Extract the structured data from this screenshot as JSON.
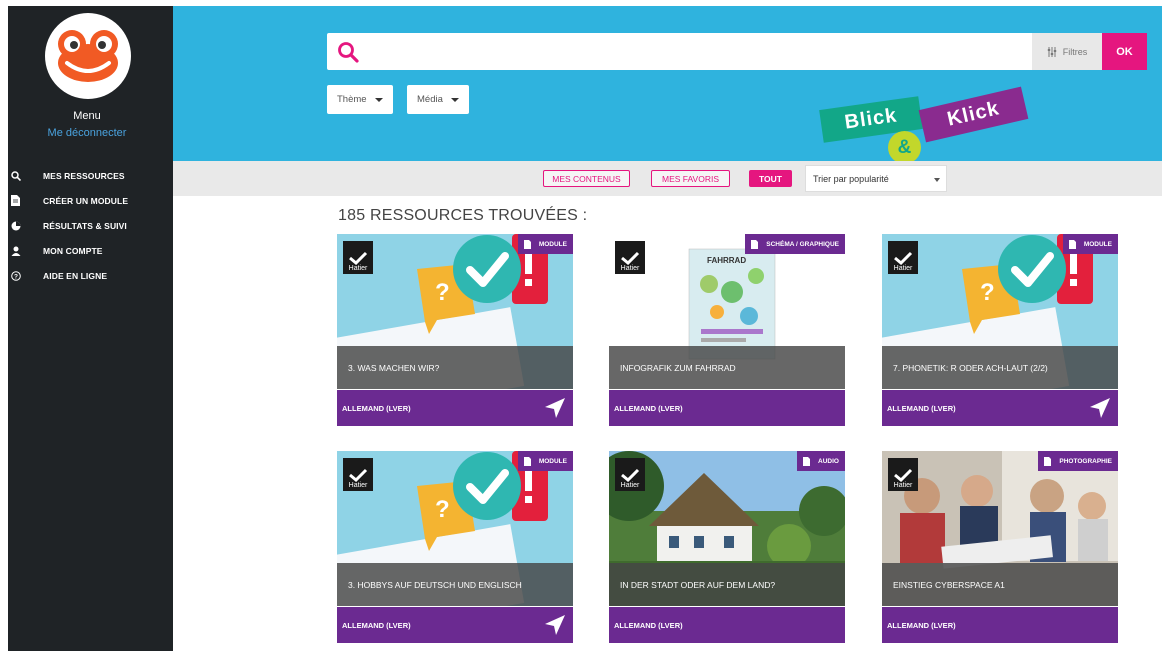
{
  "sidebar": {
    "menu_label": "Menu",
    "logout_label": "Me déconnecter",
    "items": [
      {
        "label": "MES RESSOURCES",
        "icon": "search-icon"
      },
      {
        "label": "CRÉER UN MODULE",
        "icon": "document-icon"
      },
      {
        "label": "RÉSULTATS & SUIVI",
        "icon": "pie-chart-icon"
      },
      {
        "label": "MON COMPTE",
        "icon": "user-icon"
      },
      {
        "label": "AIDE EN LIGNE",
        "icon": "help-icon"
      }
    ]
  },
  "header": {
    "search_placeholder": "",
    "filters_label": "Filtres",
    "ok_label": "OK",
    "dropdowns": [
      {
        "label": "Thème"
      },
      {
        "label": "Média"
      }
    ],
    "logo": {
      "word1": "Blick",
      "amp": "&",
      "word2": "Klick"
    }
  },
  "toolbar": {
    "pills": [
      {
        "label": "MES CONTENUS",
        "active": false
      },
      {
        "label": "MES FAVORIS",
        "active": false
      },
      {
        "label": "TOUT",
        "active": true
      }
    ],
    "sort_label": "Trier par popularité"
  },
  "results": {
    "count_title": "185 RESSOURCES TROUVÉES :",
    "cards": [
      {
        "type": "MODULE",
        "title": "3. WAS MACHEN WIR?",
        "subject": "ALLEMAND (LVER)",
        "publisher": "Hatier",
        "thumb": "module",
        "send": true
      },
      {
        "type": "SCHÉMA / GRAPHIQUE",
        "title": "INFOGRAFIK ZUM FAHRRAD",
        "subject": "ALLEMAND (LVER)",
        "publisher": "Hatier",
        "thumb": "infographic",
        "thumb_text": "FAHRRAD",
        "send": false
      },
      {
        "type": "MODULE",
        "title": "7. PHONETIK: R ODER ACH-LAUT (2/2)",
        "subject": "ALLEMAND (LVER)",
        "publisher": "Hatier",
        "thumb": "module",
        "send": true
      },
      {
        "type": "MODULE",
        "title": "3. HOBBYS AUF DEUTSCH UND ENGLISCH",
        "subject": "ALLEMAND (LVER)",
        "publisher": "Hatier",
        "thumb": "module",
        "send": true
      },
      {
        "type": "AUDIO",
        "title": "IN DER STADT ODER AUF DEM LAND?",
        "subject": "ALLEMAND (LVER)",
        "publisher": "Hatier",
        "thumb": "house",
        "send": false
      },
      {
        "type": "PHOTOGRAPHIE",
        "title": "EINSTIEG CYBERSPACE A1",
        "subject": "ALLEMAND (LVER)",
        "publisher": "Hatier",
        "thumb": "photo",
        "send": false
      }
    ]
  },
  "colors": {
    "sidebar_bg": "#1f2326",
    "header_bg": "#2fb3de",
    "accent_pink": "#e5167f",
    "purple": "#6b2a91",
    "logo_green": "#12a788",
    "logo_purple": "#8a2b8f",
    "logo_lime": "#c2d72b"
  }
}
